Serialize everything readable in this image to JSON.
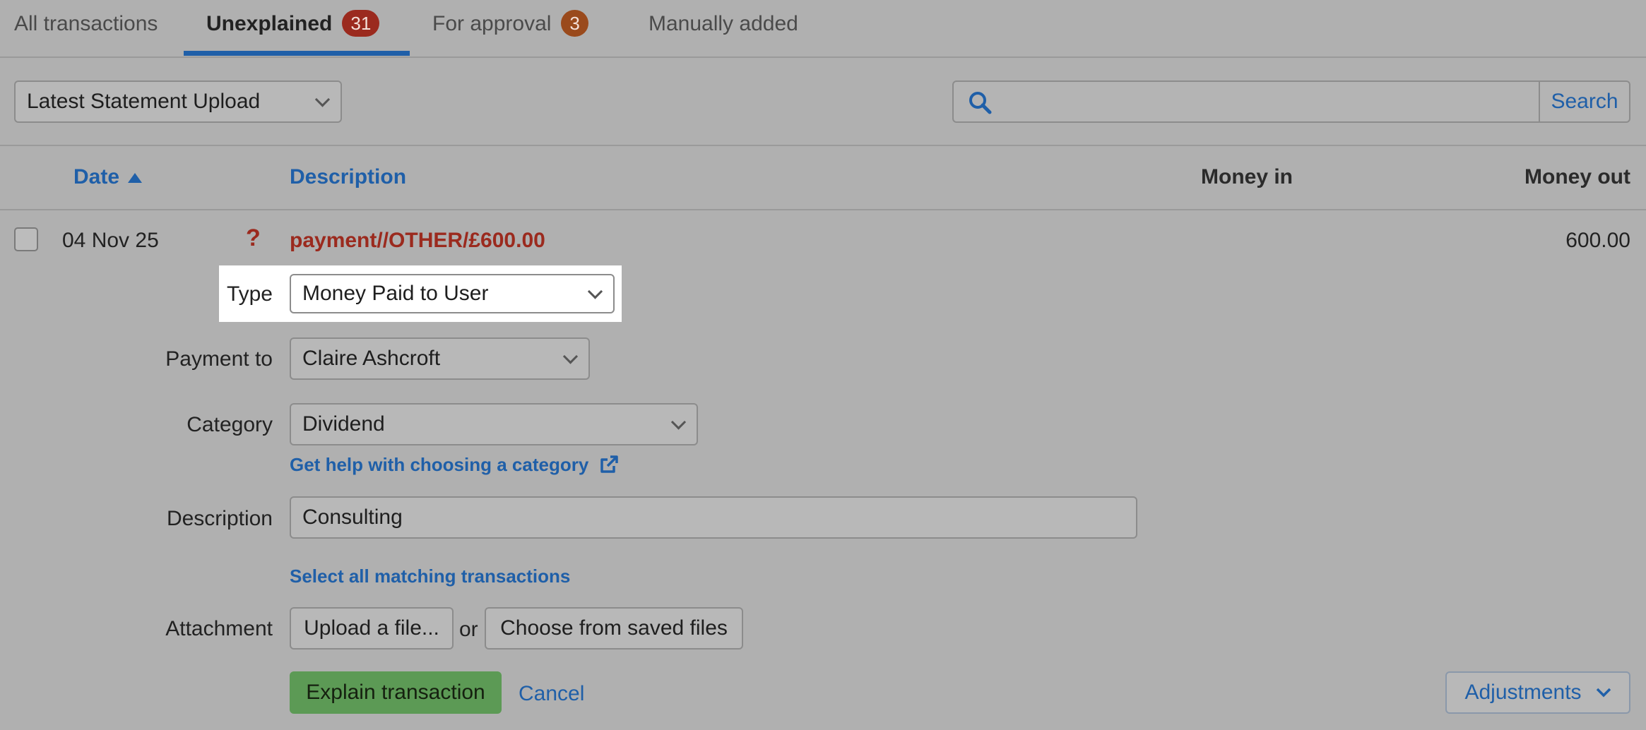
{
  "tabs": [
    {
      "label": "All transactions"
    },
    {
      "label": "Unexplained",
      "badge": "31",
      "badge_color": "#9b2a1e"
    },
    {
      "label": "For approval",
      "badge": "3",
      "badge_color": "#9a4a1c"
    },
    {
      "label": "Manually added"
    }
  ],
  "filter": {
    "statement_select": "Latest Statement Upload",
    "search_placeholder": "",
    "search_button": "Search"
  },
  "table_header": {
    "date": "Date",
    "description": "Description",
    "money_in": "Money in",
    "money_out": "Money out"
  },
  "transaction": {
    "date": "04 Nov 25",
    "status_mark": "?",
    "description": "payment//OTHER/£600.00",
    "money_out": "600.00"
  },
  "form": {
    "type_label": "Type",
    "type_value": "Money Paid to User",
    "payment_to_label": "Payment to",
    "payment_to_value": "Claire Ashcroft",
    "category_label": "Category",
    "category_value": "Dividend",
    "category_help_link": "Get help with choosing a category",
    "description_label": "Description",
    "description_value": "Consulting",
    "select_matching_link": "Select all matching transactions",
    "attachment_label": "Attachment",
    "upload_button": "Upload a file...",
    "or_text": "or",
    "choose_saved_button": "Choose from saved files",
    "explain_button": "Explain transaction",
    "cancel_link": "Cancel",
    "adjustments_button": "Adjustments"
  },
  "colors": {
    "accent": "#1f5fa8",
    "description_red": "#9b2a1e",
    "explain_green": "#5c9a55"
  }
}
